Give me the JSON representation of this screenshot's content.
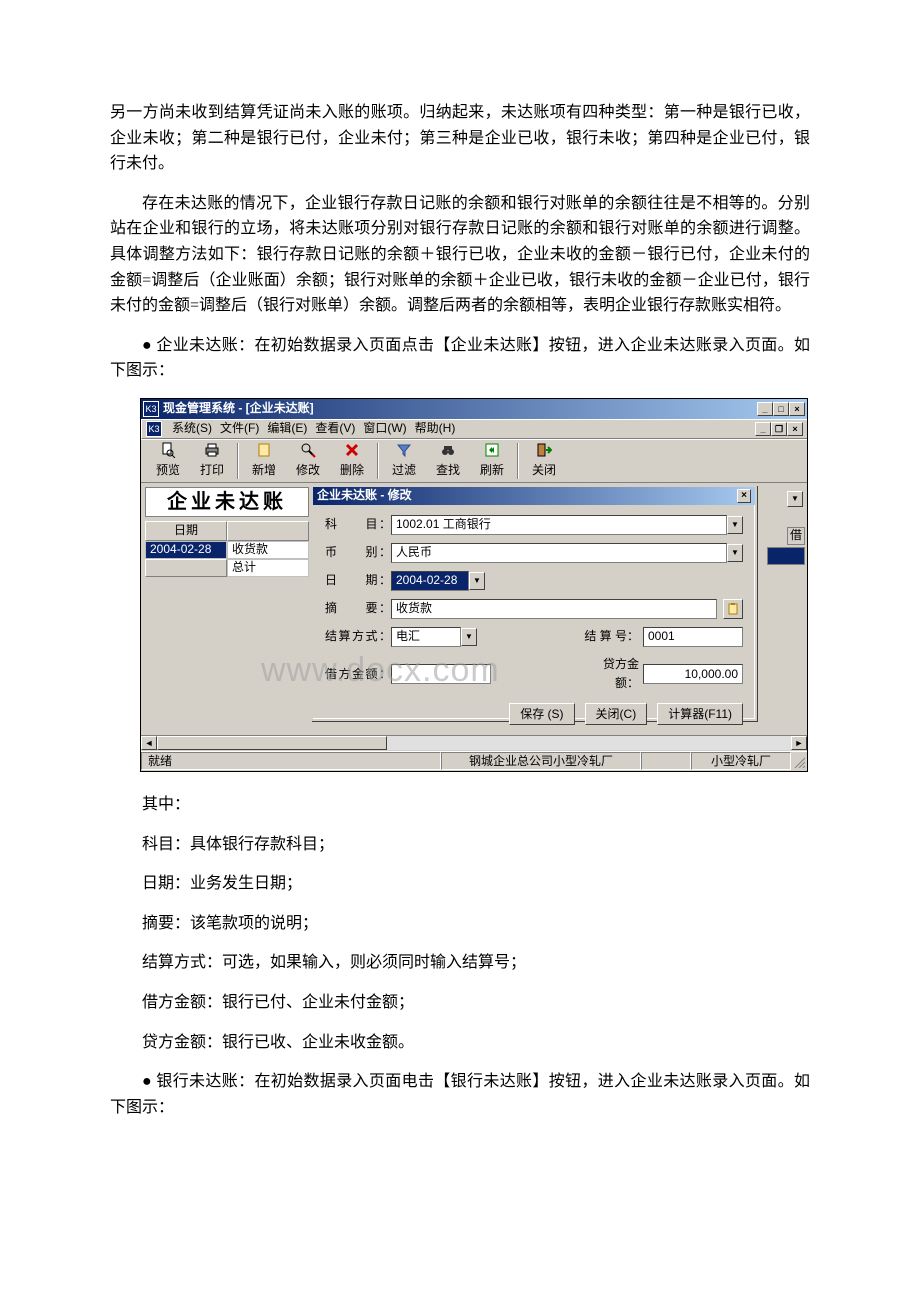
{
  "paragraphs": {
    "p1": "另一方尚未收到结算凭证尚未入账的账项。归纳起来，未达账项有四种类型：第一种是银行已收，企业未收；第二种是银行已付，企业未付；第三种是企业已收，银行未收；第四种是企业已付，银行未付。",
    "p2": "存在未达账的情况下，企业银行存款日记账的余额和银行对账单的余额往往是不相等的。分别站在企业和银行的立场，将未达账项分别对银行存款日记账的余额和银行对账单的余额进行调整。具体调整方法如下：银行存款日记账的余额＋银行已收，企业未收的金额－银行已付，企业未付的金额=调整后（企业账面）余额；银行对账单的余额＋企业已收，银行未收的金额－企业已付，银行未付的金额=调整后（银行对账单）余额。调整后两者的余额相等，表明企业银行存款账实相符。",
    "p3": "● 企业未达账：在初始数据录入页面点击【企业未达账】按钮，进入企业未达账录入页面。如下图示：",
    "p4": "其中：",
    "p5": "科目：具体银行存款科目；",
    "p6": "日期：业务发生日期；",
    "p7": "摘要：该笔款项的说明；",
    "p8": "结算方式：可选，如果输入，则必须同时输入结算号；",
    "p9": "借方金额：银行已付、企业未付金额；",
    "p10": "贷方金额：银行已收、企业未收金额。",
    "p11": "● 银行未达账：在初始数据录入页面电击【银行未达账】按钮，进入企业未达账录入页面。如下图示："
  },
  "app": {
    "icon_text": "K3",
    "window_title": "现金管理系统 - [企业未达账]",
    "menus": [
      "系统(S)",
      "文件(F)",
      "编辑(E)",
      "查看(V)",
      "窗口(W)",
      "帮助(H)"
    ],
    "toolbar": {
      "preview": "预览",
      "print": "打印",
      "new": "新增",
      "edit": "修改",
      "delete": "删除",
      "filter": "过滤",
      "find": "查找",
      "refresh": "刷新",
      "close": "关闭"
    },
    "banner": "企业未达账",
    "table": {
      "headers": {
        "date": "日期",
        "jie": "借"
      },
      "row": {
        "date": "2004-02-28",
        "summary": "收货款"
      },
      "total_label": "总计"
    },
    "dialog": {
      "title": "企业未达账 - 修改",
      "labels": {
        "subject": "科　　目：",
        "currency": "币　　别：",
        "date": "日　　期：",
        "summary": "摘　　要：",
        "settle_method": "结算方式：",
        "settle_no": "结 算 号：",
        "debit": "借方金额：",
        "credit": "贷方金额："
      },
      "values": {
        "subject": "1002.01 工商银行",
        "currency": "人民币",
        "date": "2004-02-28",
        "summary": "收货款",
        "settle_method": "电汇",
        "settle_no": "0001",
        "debit": "",
        "credit": "10,000.00"
      },
      "buttons": {
        "save": "保存 (S)",
        "close": "关闭(C)",
        "calc": "计算器(F11)"
      }
    },
    "status": {
      "ready": "就绪",
      "company": "钢城企业总公司小型冷轧厂",
      "dept": "小型冷轧厂"
    },
    "watermark": "www.docx.com"
  }
}
